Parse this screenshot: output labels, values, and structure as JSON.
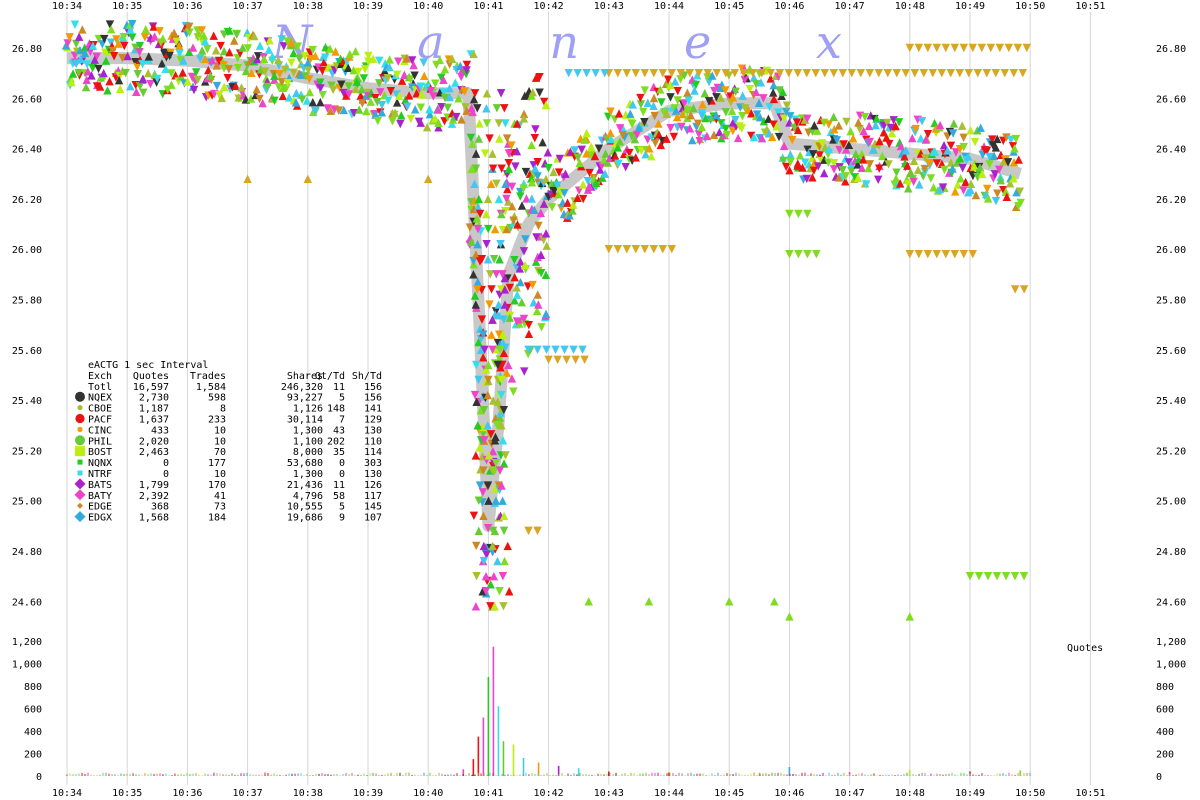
{
  "chart_data": {
    "type": "scatter",
    "watermark": "N a n e x",
    "x_ticks": [
      "10:34",
      "10:35",
      "10:36",
      "10:37",
      "10:38",
      "10:39",
      "10:40",
      "10:41",
      "10:42",
      "10:43",
      "10:44",
      "10:45",
      "10:46",
      "10:47",
      "10:48",
      "10:49",
      "10:50",
      "10:51"
    ],
    "price_panel": {
      "y_ticks": [
        "26.80",
        "26.60",
        "26.40",
        "26.20",
        "26.00",
        "25.80",
        "25.60",
        "25.40",
        "25.20",
        "25.00",
        "24.80",
        "24.60"
      ],
      "ylim": [
        24.5,
        26.9
      ],
      "nbbo_band_color": "#c8c8c8",
      "nbbo_path": [
        [
          "10:34:00",
          26.76
        ],
        [
          "10:35:00",
          26.76
        ],
        [
          "10:36:00",
          26.75
        ],
        [
          "10:37:00",
          26.73
        ],
        [
          "10:38:00",
          26.68
        ],
        [
          "10:39:00",
          26.64
        ],
        [
          "10:40:00",
          26.62
        ],
        [
          "10:40:40",
          26.62
        ],
        [
          "10:40:50",
          25.8
        ],
        [
          "10:41:00",
          24.9
        ],
        [
          "10:41:10",
          25.3
        ],
        [
          "10:41:20",
          25.9
        ],
        [
          "10:41:40",
          26.1
        ],
        [
          "10:42:00",
          26.2
        ],
        [
          "10:42:30",
          26.3
        ],
        [
          "10:43:00",
          26.4
        ],
        [
          "10:43:40",
          26.5
        ],
        [
          "10:44:00",
          26.55
        ],
        [
          "10:45:00",
          26.58
        ],
        [
          "10:45:45",
          26.58
        ],
        [
          "10:46:00",
          26.42
        ],
        [
          "10:47:00",
          26.4
        ],
        [
          "10:48:00",
          26.38
        ],
        [
          "10:49:00",
          26.36
        ],
        [
          "10:49:50",
          26.3
        ]
      ],
      "flat_quote_lines": [
        {
          "color": "#daa520",
          "y": 26.7,
          "from": "10:43:00",
          "to": "10:50:00"
        },
        {
          "color": "#daa520",
          "y": 26.8,
          "from": "10:48:00",
          "to": "10:50:00"
        },
        {
          "color": "#daa520",
          "y": 26.0,
          "from": "10:43:00",
          "to": "10:44:10"
        },
        {
          "color": "#daa520",
          "y": 25.98,
          "from": "10:48:00",
          "to": "10:49:10"
        },
        {
          "color": "#daa520",
          "y": 25.84,
          "from": "10:49:45",
          "to": "10:50:00"
        },
        {
          "color": "#daa520",
          "y": 25.56,
          "from": "10:42:00",
          "to": "10:42:40"
        },
        {
          "color": "#daa520",
          "y": 24.88,
          "from": "10:41:40",
          "to": "10:41:50"
        },
        {
          "color": "#7fdd21",
          "y": 24.7,
          "from": "10:49:00",
          "to": "10:50:00"
        },
        {
          "color": "#7fdd21",
          "y": 25.98,
          "from": "10:46:00",
          "to": "10:46:30"
        },
        {
          "color": "#7fdd21",
          "y": 26.14,
          "from": "10:46:00",
          "to": "10:46:20"
        },
        {
          "color": "#40c8f0",
          "y": 25.6,
          "from": "10:41:40",
          "to": "10:42:40"
        },
        {
          "color": "#40c8f0",
          "y": 26.7,
          "from": "10:42:20",
          "to": "10:43:00"
        }
      ],
      "isolated_points": [
        {
          "color": "#7fdd21",
          "t": "10:42:40",
          "y": 24.6
        },
        {
          "color": "#7fdd21",
          "t": "10:43:40",
          "y": 24.6
        },
        {
          "color": "#7fdd21",
          "t": "10:45:00",
          "y": 24.6
        },
        {
          "color": "#7fdd21",
          "t": "10:45:45",
          "y": 24.6
        },
        {
          "color": "#7fdd21",
          "t": "10:46:00",
          "y": 24.54
        },
        {
          "color": "#7fdd21",
          "t": "10:48:00",
          "y": 24.54
        },
        {
          "color": "#daa520",
          "t": "10:37:00",
          "y": 26.28
        },
        {
          "color": "#daa520",
          "t": "10:38:00",
          "y": 26.28
        },
        {
          "color": "#daa520",
          "t": "10:40:00",
          "y": 26.28
        }
      ]
    },
    "quote_panel": {
      "label": "Quotes",
      "y_ticks": [
        "1,200",
        "1,000",
        "800",
        "600",
        "400",
        "200",
        "0"
      ],
      "ylim": [
        0,
        1200
      ],
      "spikes": [
        {
          "t": "10:40:35",
          "v": 60
        },
        {
          "t": "10:40:45",
          "v": 150
        },
        {
          "t": "10:40:50",
          "v": 350
        },
        {
          "t": "10:40:55",
          "v": 520
        },
        {
          "t": "10:41:00",
          "v": 880
        },
        {
          "t": "10:41:05",
          "v": 1150
        },
        {
          "t": "10:41:10",
          "v": 620
        },
        {
          "t": "10:41:15",
          "v": 310
        },
        {
          "t": "10:41:25",
          "v": 280
        },
        {
          "t": "10:41:35",
          "v": 160
        },
        {
          "t": "10:41:50",
          "v": 120
        },
        {
          "t": "10:42:10",
          "v": 90
        },
        {
          "t": "10:42:30",
          "v": 70
        },
        {
          "t": "10:43:00",
          "v": 40
        },
        {
          "t": "10:44:00",
          "v": 30
        },
        {
          "t": "10:45:30",
          "v": 30
        },
        {
          "t": "10:46:00",
          "v": 80
        },
        {
          "t": "10:47:00",
          "v": 35
        },
        {
          "t": "10:48:00",
          "v": 55
        },
        {
          "t": "10:49:00",
          "v": 40
        },
        {
          "t": "10:49:50",
          "v": 50
        }
      ]
    },
    "legend": {
      "title": "eACTG 1 sec Interval",
      "columns": [
        "Exch",
        "Quotes",
        "Trades",
        "Shares",
        "Qt/Td",
        "Sh/Td"
      ],
      "rows": [
        {
          "exch": "Totl",
          "quotes": "16,597",
          "trades": "1,584",
          "shares": "246,320",
          "qt_td": "11",
          "sh_td": "156",
          "color": "",
          "marker": "none"
        },
        {
          "exch": "NQEX",
          "quotes": "2,730",
          "trades": "598",
          "shares": "93,227",
          "qt_td": "5",
          "sh_td": "156",
          "color": "#333333",
          "marker": "circle"
        },
        {
          "exch": "CBOE",
          "quotes": "1,187",
          "trades": "8",
          "shares": "1,126",
          "qt_td": "148",
          "sh_td": "141",
          "color": "#a8c030",
          "marker": "small-circle"
        },
        {
          "exch": "PACF",
          "quotes": "1,637",
          "trades": "233",
          "shares": "30,114",
          "qt_td": "7",
          "sh_td": "129",
          "color": "#ee1111",
          "marker": "octagon"
        },
        {
          "exch": "CINC",
          "quotes": "433",
          "trades": "10",
          "shares": "1,300",
          "qt_td": "43",
          "sh_td": "130",
          "color": "#f29a00",
          "marker": "small-circle"
        },
        {
          "exch": "PHIL",
          "quotes": "2,020",
          "trades": "10",
          "shares": "1,100",
          "qt_td": "202",
          "sh_td": "110",
          "color": "#66cc33",
          "marker": "circle"
        },
        {
          "exch": "BOST",
          "quotes": "2,463",
          "trades": "70",
          "shares": "8,000",
          "qt_td": "35",
          "sh_td": "114",
          "color": "#bbee11",
          "marker": "square"
        },
        {
          "exch": "NQNX",
          "quotes": "0",
          "trades": "177",
          "shares": "53,680",
          "qt_td": "0",
          "sh_td": "303",
          "color": "#22cc22",
          "marker": "small-square"
        },
        {
          "exch": "NTRF",
          "quotes": "0",
          "trades": "10",
          "shares": "1,300",
          "qt_td": "0",
          "sh_td": "130",
          "color": "#33ddee",
          "marker": "small-square"
        },
        {
          "exch": "BATS",
          "quotes": "1,799",
          "trades": "170",
          "shares": "21,436",
          "qt_td": "11",
          "sh_td": "126",
          "color": "#aa22cc",
          "marker": "diamond"
        },
        {
          "exch": "BATY",
          "quotes": "2,392",
          "trades": "41",
          "shares": "4,796",
          "qt_td": "58",
          "sh_td": "117",
          "color": "#ee44cc",
          "marker": "diamond"
        },
        {
          "exch": "EDGE",
          "quotes": "368",
          "trades": "73",
          "shares": "10,555",
          "qt_td": "5",
          "sh_td": "145",
          "color": "#cc8822",
          "marker": "small-diamond"
        },
        {
          "exch": "EDGX",
          "quotes": "1,568",
          "trades": "184",
          "shares": "19,686",
          "qt_td": "9",
          "sh_td": "107",
          "color": "#33aadd",
          "marker": "diamond"
        }
      ]
    }
  }
}
